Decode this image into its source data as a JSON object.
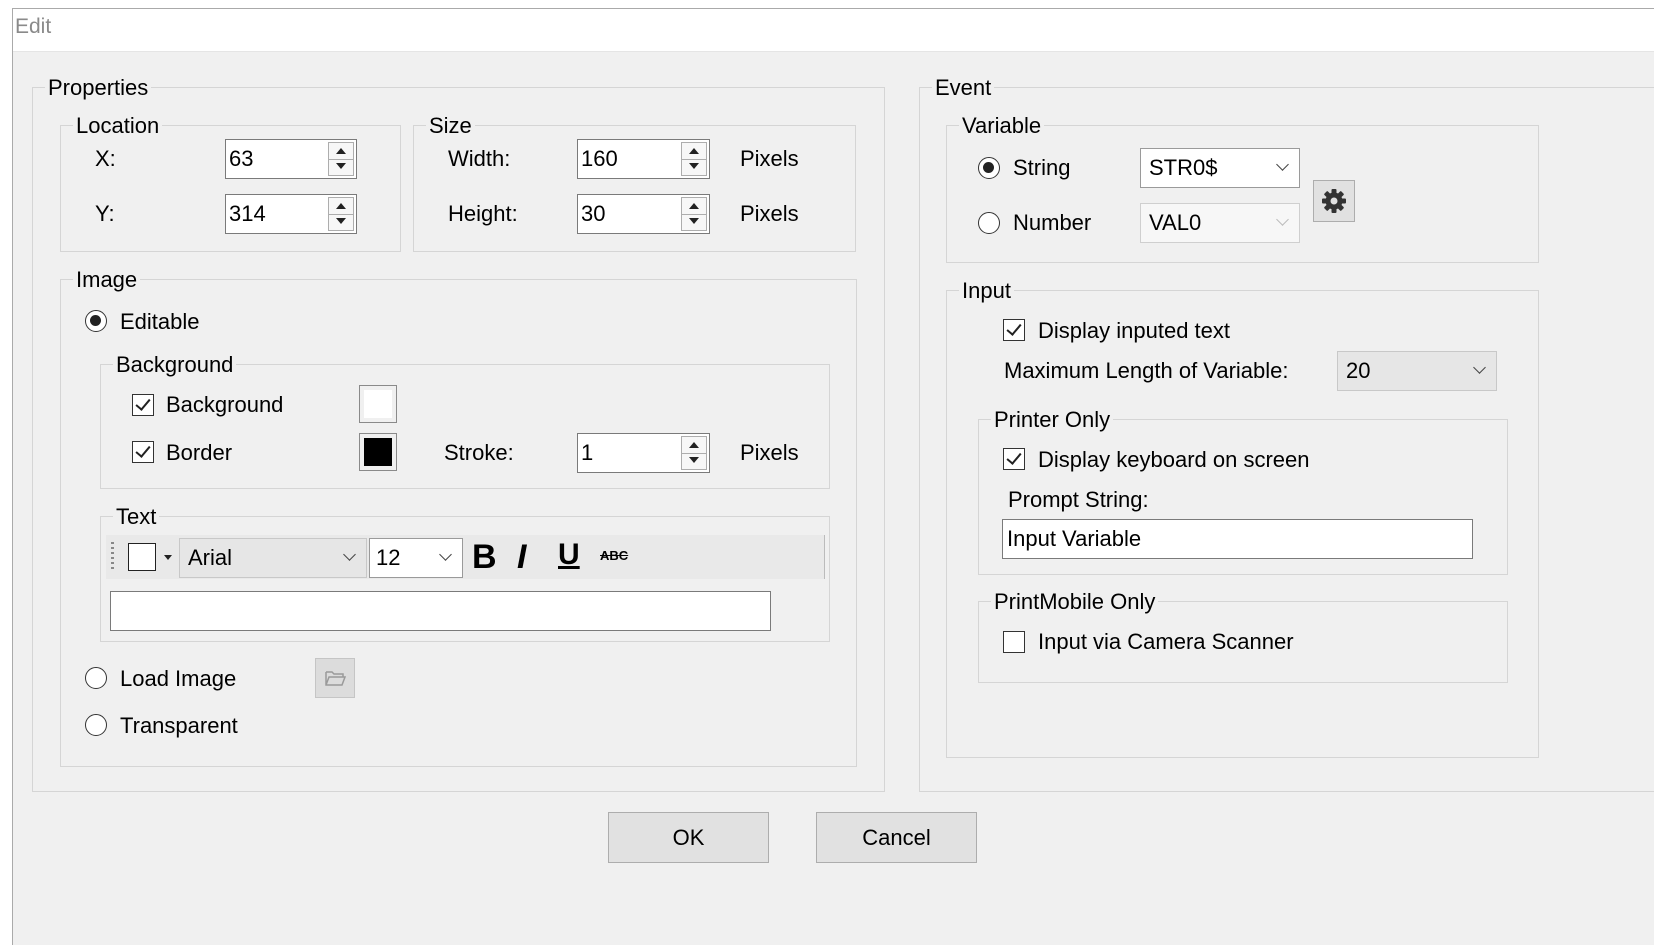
{
  "window": {
    "title": "Edit"
  },
  "properties": {
    "label": "Properties",
    "location": {
      "label": "Location",
      "x_label": "X:",
      "x_value": "63",
      "y_label": "Y:",
      "y_value": "314"
    },
    "size": {
      "label": "Size",
      "width_label": "Width:",
      "width_value": "160",
      "width_unit": "Pixels",
      "height_label": "Height:",
      "height_value": "30",
      "height_unit": "Pixels"
    },
    "image": {
      "label": "Image",
      "editable_label": "Editable",
      "background_group": {
        "label": "Background",
        "background_label": "Background",
        "background_color": "#ffffff",
        "border_label": "Border",
        "border_color": "#000000",
        "stroke_label": "Stroke:",
        "stroke_value": "1",
        "stroke_unit": "Pixels"
      },
      "text_group": {
        "label": "Text",
        "font": "Arial",
        "font_size": "12",
        "bold": "B",
        "italic": "I",
        "underline": "U",
        "strike": "ABC",
        "text_value": ""
      },
      "load_image_label": "Load Image",
      "transparent_label": "Transparent"
    }
  },
  "event": {
    "label": "Event",
    "variable": {
      "label": "Variable",
      "string_label": "String",
      "string_value": "STR0$",
      "number_label": "Number",
      "number_value": "VAL0"
    },
    "input": {
      "label": "Input",
      "display_inputed_label": "Display inputed text",
      "max_length_label": "Maximum Length of Variable:",
      "max_length_value": "20",
      "printer_only": {
        "label": "Printer Only",
        "display_keyboard_label": "Display keyboard on screen",
        "prompt_label": "Prompt String:",
        "prompt_value": "Input Variable"
      },
      "printmobile_only": {
        "label": "PrintMobile Only",
        "camera_label": "Input via Camera Scanner"
      }
    }
  },
  "buttons": {
    "ok": "OK",
    "cancel": "Cancel"
  }
}
